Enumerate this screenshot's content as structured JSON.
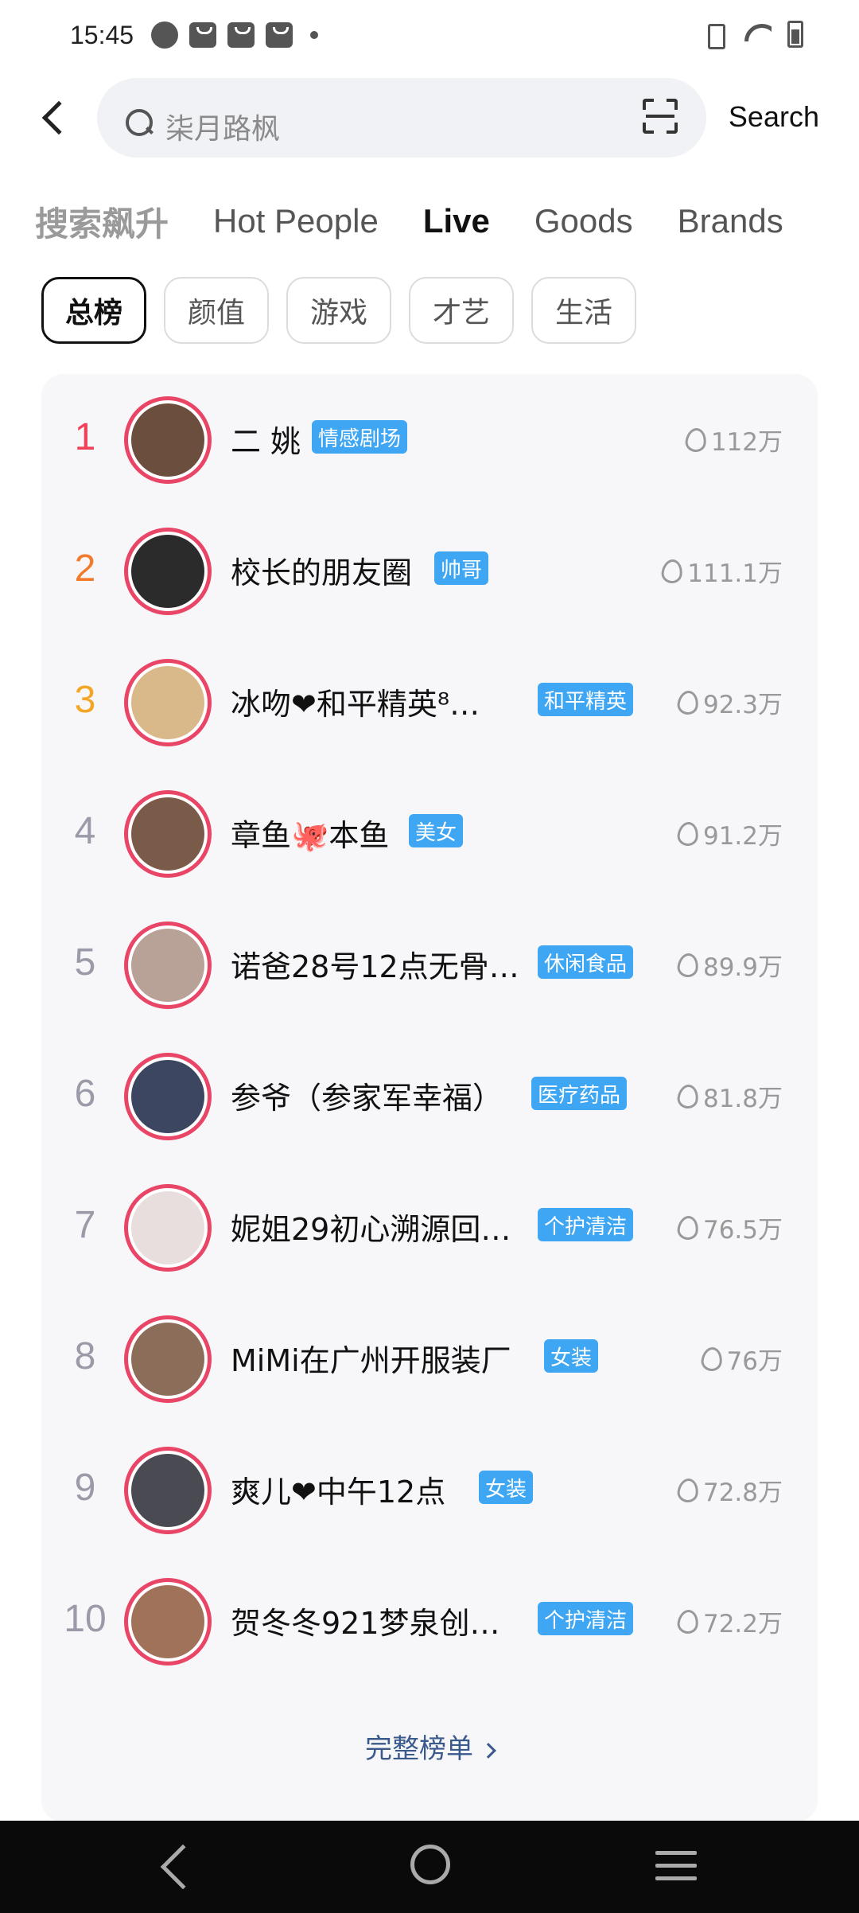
{
  "status_bar": {
    "time": "15:45"
  },
  "search": {
    "placeholder": "柒月路枫",
    "button_label": "Search"
  },
  "category_tabs": [
    {
      "label": "搜索飙升"
    },
    {
      "label": "Hot People"
    },
    {
      "label": "Live"
    },
    {
      "label": "Goods"
    },
    {
      "label": "Brands"
    }
  ],
  "filter_chips": [
    {
      "label": "总榜"
    },
    {
      "label": "颜值"
    },
    {
      "label": "游戏"
    },
    {
      "label": "才艺"
    },
    {
      "label": "生活"
    }
  ],
  "ranking": [
    {
      "rank": "1",
      "name": "二 姚",
      "tag": "情感剧场",
      "heat": "112万",
      "avatar_color": "#6b4e3d"
    },
    {
      "rank": "2",
      "name": "校长的朋友圈",
      "tag": "帅哥",
      "heat": "111.1万",
      "avatar_color": "#2b2b2b"
    },
    {
      "rank": "3",
      "name": "冰吻❤和平精英⁸…",
      "tag": "和平精英",
      "heat": "92.3万",
      "avatar_color": "#d9b98a"
    },
    {
      "rank": "4",
      "name": "章鱼🐙本鱼",
      "tag": "美女",
      "heat": "91.2万",
      "avatar_color": "#7a5b4a"
    },
    {
      "rank": "5",
      "name": "诺爸28号12点无骨…",
      "tag": "休闲食品",
      "heat": "89.9万",
      "avatar_color": "#b8a196"
    },
    {
      "rank": "6",
      "name": "参爷（参家军幸福）",
      "tag": "医疗药品",
      "heat": "81.8万",
      "avatar_color": "#3c4660"
    },
    {
      "rank": "7",
      "name": "妮姐29初心溯源回…",
      "tag": "个护清洁",
      "heat": "76.5万",
      "avatar_color": "#e8dede"
    },
    {
      "rank": "8",
      "name": "MiMi在广州开服装厂",
      "tag": "女装",
      "heat": "76万",
      "avatar_color": "#8c6d5a"
    },
    {
      "rank": "9",
      "name": "爽儿❤中午12点",
      "tag": "女装",
      "heat": "72.8万",
      "avatar_color": "#4a4a52"
    },
    {
      "rank": "10",
      "name": "贺冬冬921梦泉创…",
      "tag": "个护清洁",
      "heat": "72.2万",
      "avatar_color": "#a0725a"
    }
  ],
  "full_list_label": "完整榜单",
  "colors": {
    "avatar_ring": "#e94566",
    "tag_bg": "#3ea6f2",
    "rank1": "#f0405a",
    "rank2": "#f27a2a",
    "rank3": "#f4a524",
    "rank_other": "#9a9aa8"
  }
}
